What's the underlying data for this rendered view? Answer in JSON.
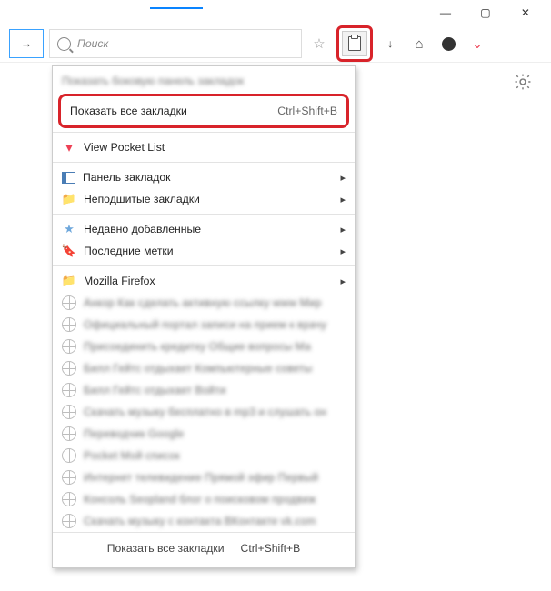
{
  "window": {
    "minimize": "—",
    "maximize": "▢",
    "close": "✕"
  },
  "toolbar": {
    "forward": "→",
    "search_placeholder": "Поиск",
    "download": "↓"
  },
  "menu": {
    "truncated_top": "Показать боковую панель закладок",
    "show_all": "Показать все закладки",
    "show_all_shortcut": "Ctrl+Shift+B",
    "pocket": "View Pocket List",
    "panel": "Панель закладок",
    "unfiled": "Неподшитые закладки",
    "recent": "Недавно добавленные",
    "tags": "Последние метки",
    "firefox": "Mozilla Firefox",
    "footer_label": "Показать все закладки",
    "footer_shortcut": "Ctrl+Shift+B",
    "bookmarks": [
      "Анкор Как сделать активную ссылку www Мир",
      "Официальный портал записи на прием к врачу",
      "Присоединить кредитку Общие вопросы Ма",
      "Билл Гейтс отдыхает Компьютерные советы",
      "Билл Гейтс отдыхает Войти",
      "Скачать музыку бесплатно в mp3 и слушать он",
      "Переводчик Google",
      "Pocket Мой список",
      "Интернет телевидение Прямой эфир Первый",
      "Консоль Seopland блог о поисковом продвиж",
      "Скачать музыку с контакта ВКонтакте vk.com"
    ]
  }
}
